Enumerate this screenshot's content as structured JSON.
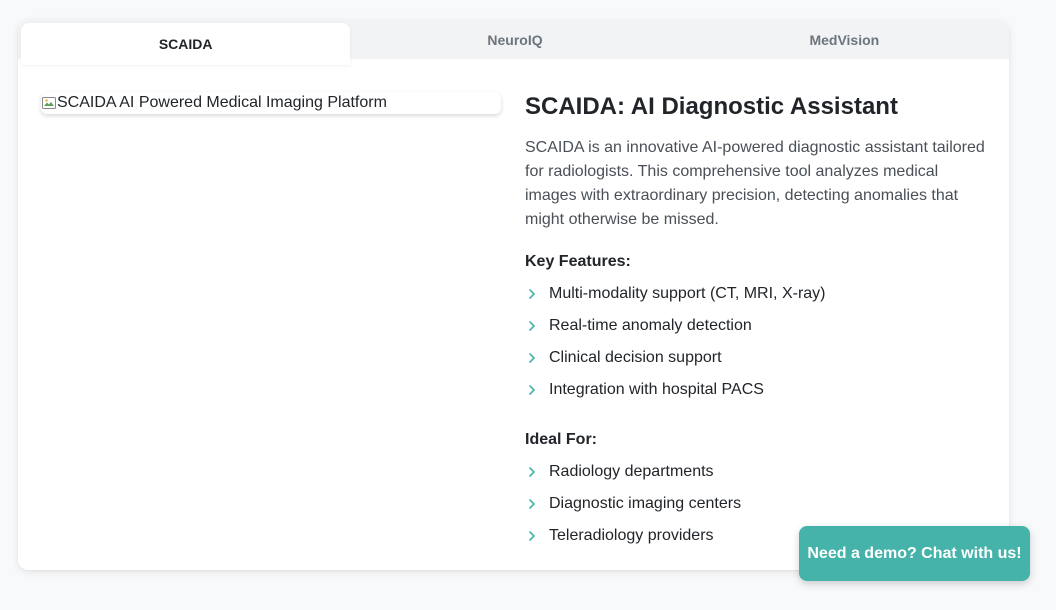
{
  "tabs": [
    {
      "label": "SCAIDA",
      "active": true
    },
    {
      "label": "NeuroIQ",
      "active": false
    },
    {
      "label": "MedVision",
      "active": false
    }
  ],
  "image": {
    "alt": "SCAIDA AI Powered Medical Imaging Platform"
  },
  "product": {
    "title": "SCAIDA: AI Diagnostic Assistant",
    "description": "SCAIDA is an innovative AI-powered diagnostic assistant tailored for radiologists. This comprehensive tool analyzes medical images with extraordinary precision, detecting anomalies that might otherwise be missed.",
    "key_features_heading": "Key Features:",
    "key_features": [
      "Multi-modality support (CT, MRI, X-ray)",
      "Real-time anomaly detection",
      "Clinical decision support",
      "Integration with hospital PACS"
    ],
    "ideal_for_heading": "Ideal For:",
    "ideal_for": [
      "Radiology departments",
      "Diagnostic imaging centers",
      "Teleradiology providers"
    ]
  },
  "chat_button": {
    "label": "Need a demo? Chat with us!"
  },
  "colors": {
    "accent": "#45b3a9",
    "chevron": "#45b3a9",
    "background": "#f8f9fa"
  },
  "icons": {
    "list_bullet": "chevron-right-icon",
    "broken_image": "broken-image-icon"
  }
}
